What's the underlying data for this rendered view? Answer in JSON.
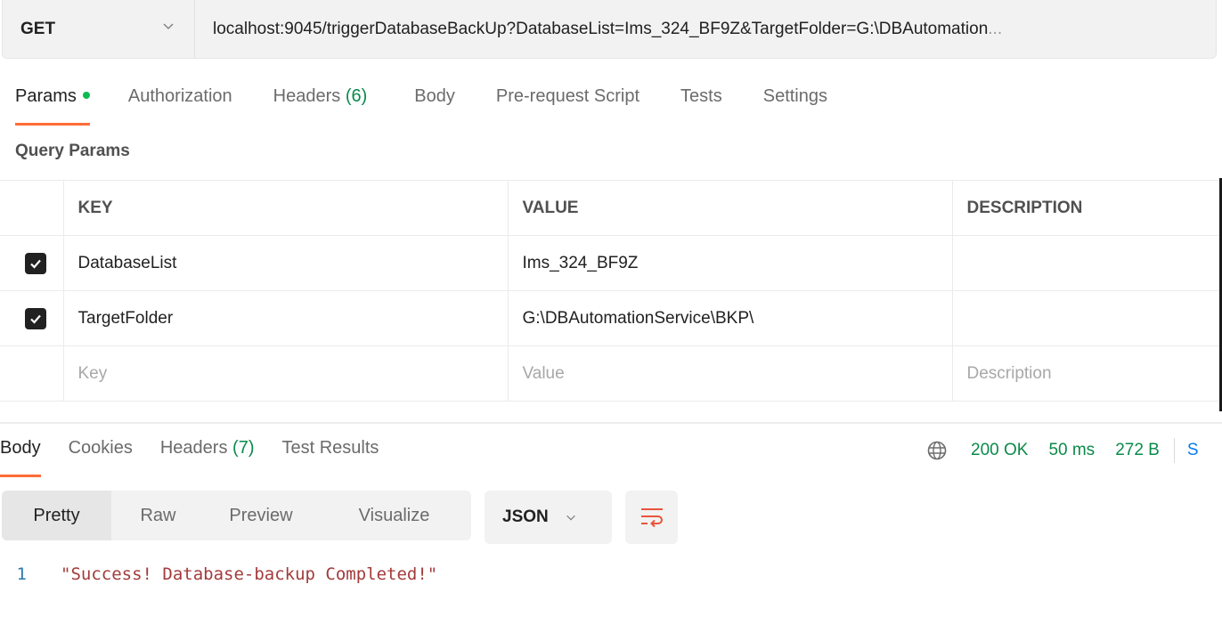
{
  "request": {
    "method": "GET",
    "url": "localhost:9045/triggerDatabaseBackUp?DatabaseList=Ims_324_BF9Z&TargetFolder=G:\\DBAutomation",
    "url_ellipsis": "..."
  },
  "request_tabs": [
    {
      "label": "Params",
      "active": true,
      "has_dot": true
    },
    {
      "label": "Authorization"
    },
    {
      "label": "Headers",
      "count": "(6)"
    },
    {
      "label": "Body"
    },
    {
      "label": "Pre-request Script"
    },
    {
      "label": "Tests"
    },
    {
      "label": "Settings"
    }
  ],
  "query_params": {
    "title": "Query Params",
    "columns": [
      "KEY",
      "VALUE",
      "DESCRIPTION"
    ],
    "rows": [
      {
        "checked": true,
        "key": "DatabaseList",
        "value": "Ims_324_BF9Z",
        "description": ""
      },
      {
        "checked": true,
        "key": "TargetFolder",
        "value": "G:\\DBAutomationService\\BKP\\",
        "description": ""
      }
    ],
    "placeholders": {
      "key": "Key",
      "value": "Value",
      "description": "Description"
    }
  },
  "response_tabs": [
    {
      "label": "Body",
      "active": true
    },
    {
      "label": "Cookies"
    },
    {
      "label": "Headers",
      "count": "(7)"
    },
    {
      "label": "Test Results"
    }
  ],
  "response_meta": {
    "status": "200 OK",
    "time": "50 ms",
    "size": "272 B",
    "save_truncated": "S"
  },
  "view_modes": [
    "Pretty",
    "Raw",
    "Preview",
    "Visualize"
  ],
  "active_view_mode": "Pretty",
  "format": "JSON",
  "response_body": {
    "lines": [
      {
        "number": "1",
        "text": "\"Success! Database-backup Completed!\""
      }
    ]
  },
  "colors": {
    "accent": "#ff6c37",
    "success": "#0a8a4a",
    "status_dot": "#0cbb52"
  }
}
